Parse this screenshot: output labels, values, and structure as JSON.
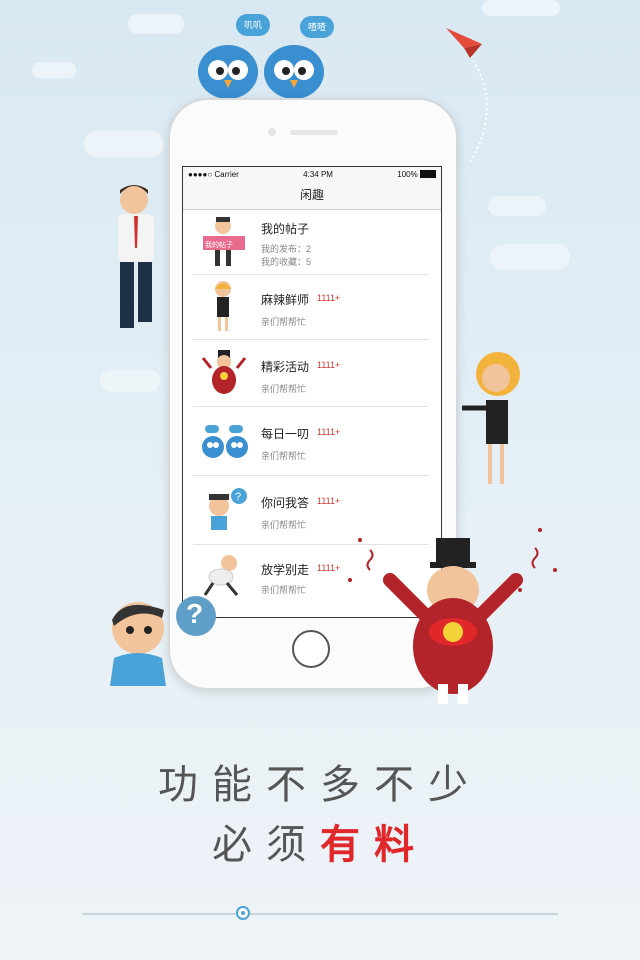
{
  "status": {
    "carrier": "●●●●○ Carrier",
    "time": "4:34 PM",
    "battery": "100%"
  },
  "nav": {
    "title": "闲趣"
  },
  "rows": [
    {
      "title": "我的帖子",
      "sub1": "我的发布：2",
      "sub2": "我的收藏：5",
      "sign": "我的帖子"
    },
    {
      "title": "麻辣鲜师",
      "count": "1111+",
      "sub": "亲们帮帮忙"
    },
    {
      "title": "精彩活动",
      "count": "1111+",
      "sub": "亲们帮帮忙"
    },
    {
      "title": "每日一叨",
      "count": "1111+",
      "sub": "亲们帮帮忙"
    },
    {
      "title": "你问我答",
      "count": "1111+",
      "sub": "亲们帮帮忙"
    },
    {
      "title": "放学别走",
      "count": "1111+",
      "sub": "亲们帮帮忙"
    }
  ],
  "birds": {
    "left_bubble": "叽叽",
    "right_bubble": "喳喳"
  },
  "slogan": {
    "line1": "功能不多不少",
    "line2_plain": "必须",
    "line2_bold": "有料"
  },
  "colors": {
    "accent": "#e0272a",
    "blue": "#4aa3d8"
  }
}
